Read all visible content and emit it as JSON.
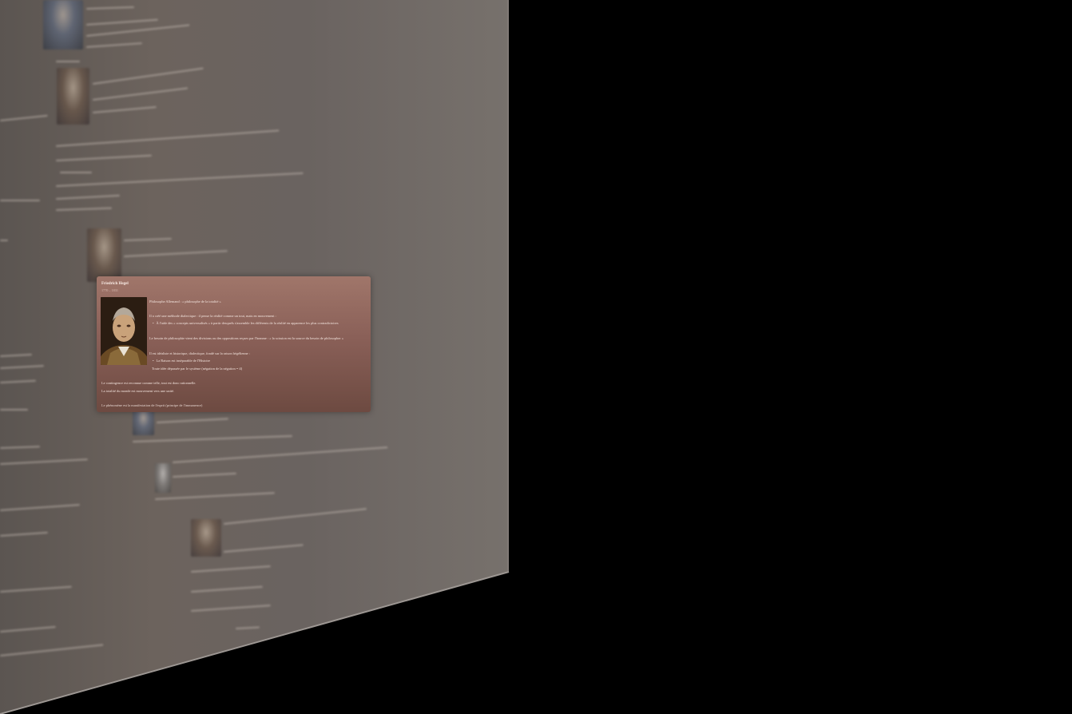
{
  "popup": {
    "name": "Friedrich Hegel",
    "years": "1770 – 1831",
    "tagline": "Philosophe Allemand : « philosophe de la totalité »",
    "line1": "Il a créé une méthode dialectique : il pense la réalité comme un tout, mais en mouvement :",
    "bullet1": "À l'aide des « concepts universalisés » à partir desquels s'assemble les différents de la réalité en apparence les plus contradictoires",
    "line2": "Le besoin de philosophie vient des divisions ou des oppositions reçues par l'homme : « la scission est la source du besoin de philosopher »",
    "line3": "Il est idéaliste et historique, dialectique, fondé sur la raison hégélienne :",
    "bullet2": "La Raison est inséparable de l'Histoire",
    "line4": "Toute idée dépassée par le système (négation de la négation = il)",
    "line5": "Le contingence est reconnue comme telle, tout est donc rationnelle.",
    "line6": "La totalité du monde est mouvement vers une unité.",
    "line7": "Le phénomène est la manifestation de l'esprit (principe de l'immanence)"
  },
  "thumbnails": [
    {
      "tone": "blue"
    },
    {
      "tone": "warm"
    },
    {
      "tone": "warm"
    },
    {
      "tone": "blue"
    },
    {
      "tone": "grey"
    },
    {
      "tone": "warm"
    }
  ]
}
